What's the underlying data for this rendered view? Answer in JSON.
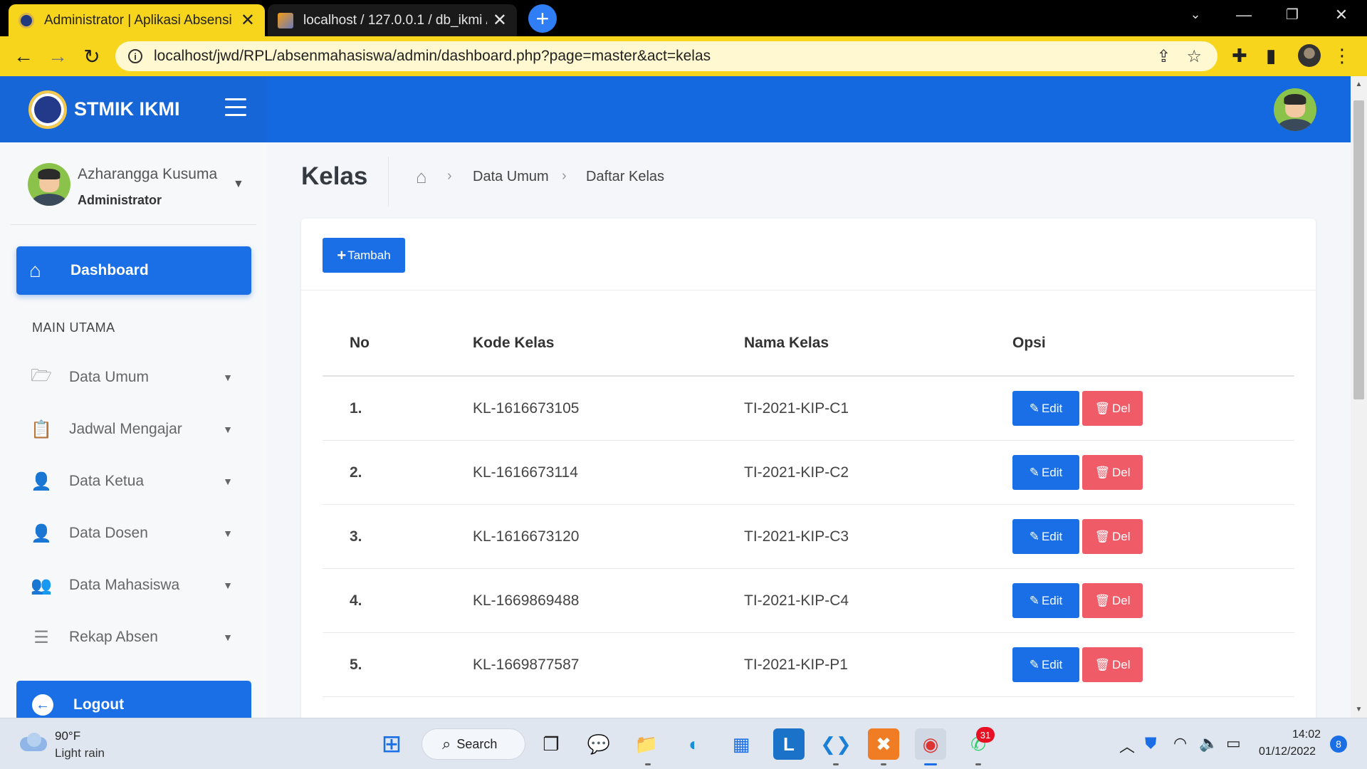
{
  "browser": {
    "tabs": [
      {
        "title": "Administrator | Aplikasi Absensi",
        "active": true
      },
      {
        "title": "localhost / 127.0.0.1 / db_ikmi / t",
        "active": false
      }
    ],
    "url": "localhost/jwd/RPL/absenmahasiswa/admin/dashboard.php?page=master&act=kelas"
  },
  "header": {
    "brand": "STMIK IKMI"
  },
  "sidebar": {
    "user_name": "Azharangga Kusuma",
    "user_role": "Administrator",
    "dashboard_label": "Dashboard",
    "section_header": "MAIN UTAMA",
    "items": [
      {
        "label": "Data Umum",
        "icon": "folder-open-icon"
      },
      {
        "label": "Jadwal Mengajar",
        "icon": "clipboard-icon"
      },
      {
        "label": "Data Ketua",
        "icon": "user-tie-icon"
      },
      {
        "label": "Data Dosen",
        "icon": "user-tie-icon"
      },
      {
        "label": "Data Mahasiswa",
        "icon": "users-icon"
      },
      {
        "label": "Rekap Absen",
        "icon": "list-icon"
      }
    ],
    "logout_label": "Logout"
  },
  "page": {
    "title": "Kelas",
    "breadcrumb": [
      "Data Umum",
      "Daftar Kelas"
    ],
    "add_button": "Tambah"
  },
  "table": {
    "headers": {
      "no": "No",
      "kode": "Kode Kelas",
      "nama": "Nama Kelas",
      "opsi": "Opsi"
    },
    "rows": [
      {
        "no": "1.",
        "kode": "KL-1616673105",
        "nama": "TI-2021-KIP-C1"
      },
      {
        "no": "2.",
        "kode": "KL-1616673114",
        "nama": "TI-2021-KIP-C2"
      },
      {
        "no": "3.",
        "kode": "KL-1616673120",
        "nama": "TI-2021-KIP-C3"
      },
      {
        "no": "4.",
        "kode": "KL-1669869488",
        "nama": "TI-2021-KIP-C4"
      },
      {
        "no": "5.",
        "kode": "KL-1669877587",
        "nama": "TI-2021-KIP-P1"
      }
    ],
    "edit_label": "Edit",
    "del_label": "Del"
  },
  "taskbar": {
    "temperature": "90°F",
    "weather": "Light rain",
    "search_label": "Search",
    "whatsapp_badge": "31",
    "time": "14:02",
    "date": "01/12/2022",
    "notifications": "8"
  },
  "colors": {
    "primary": "#1a6fe6",
    "danger": "#ef5b67",
    "tab_accent": "#f7d51c"
  }
}
